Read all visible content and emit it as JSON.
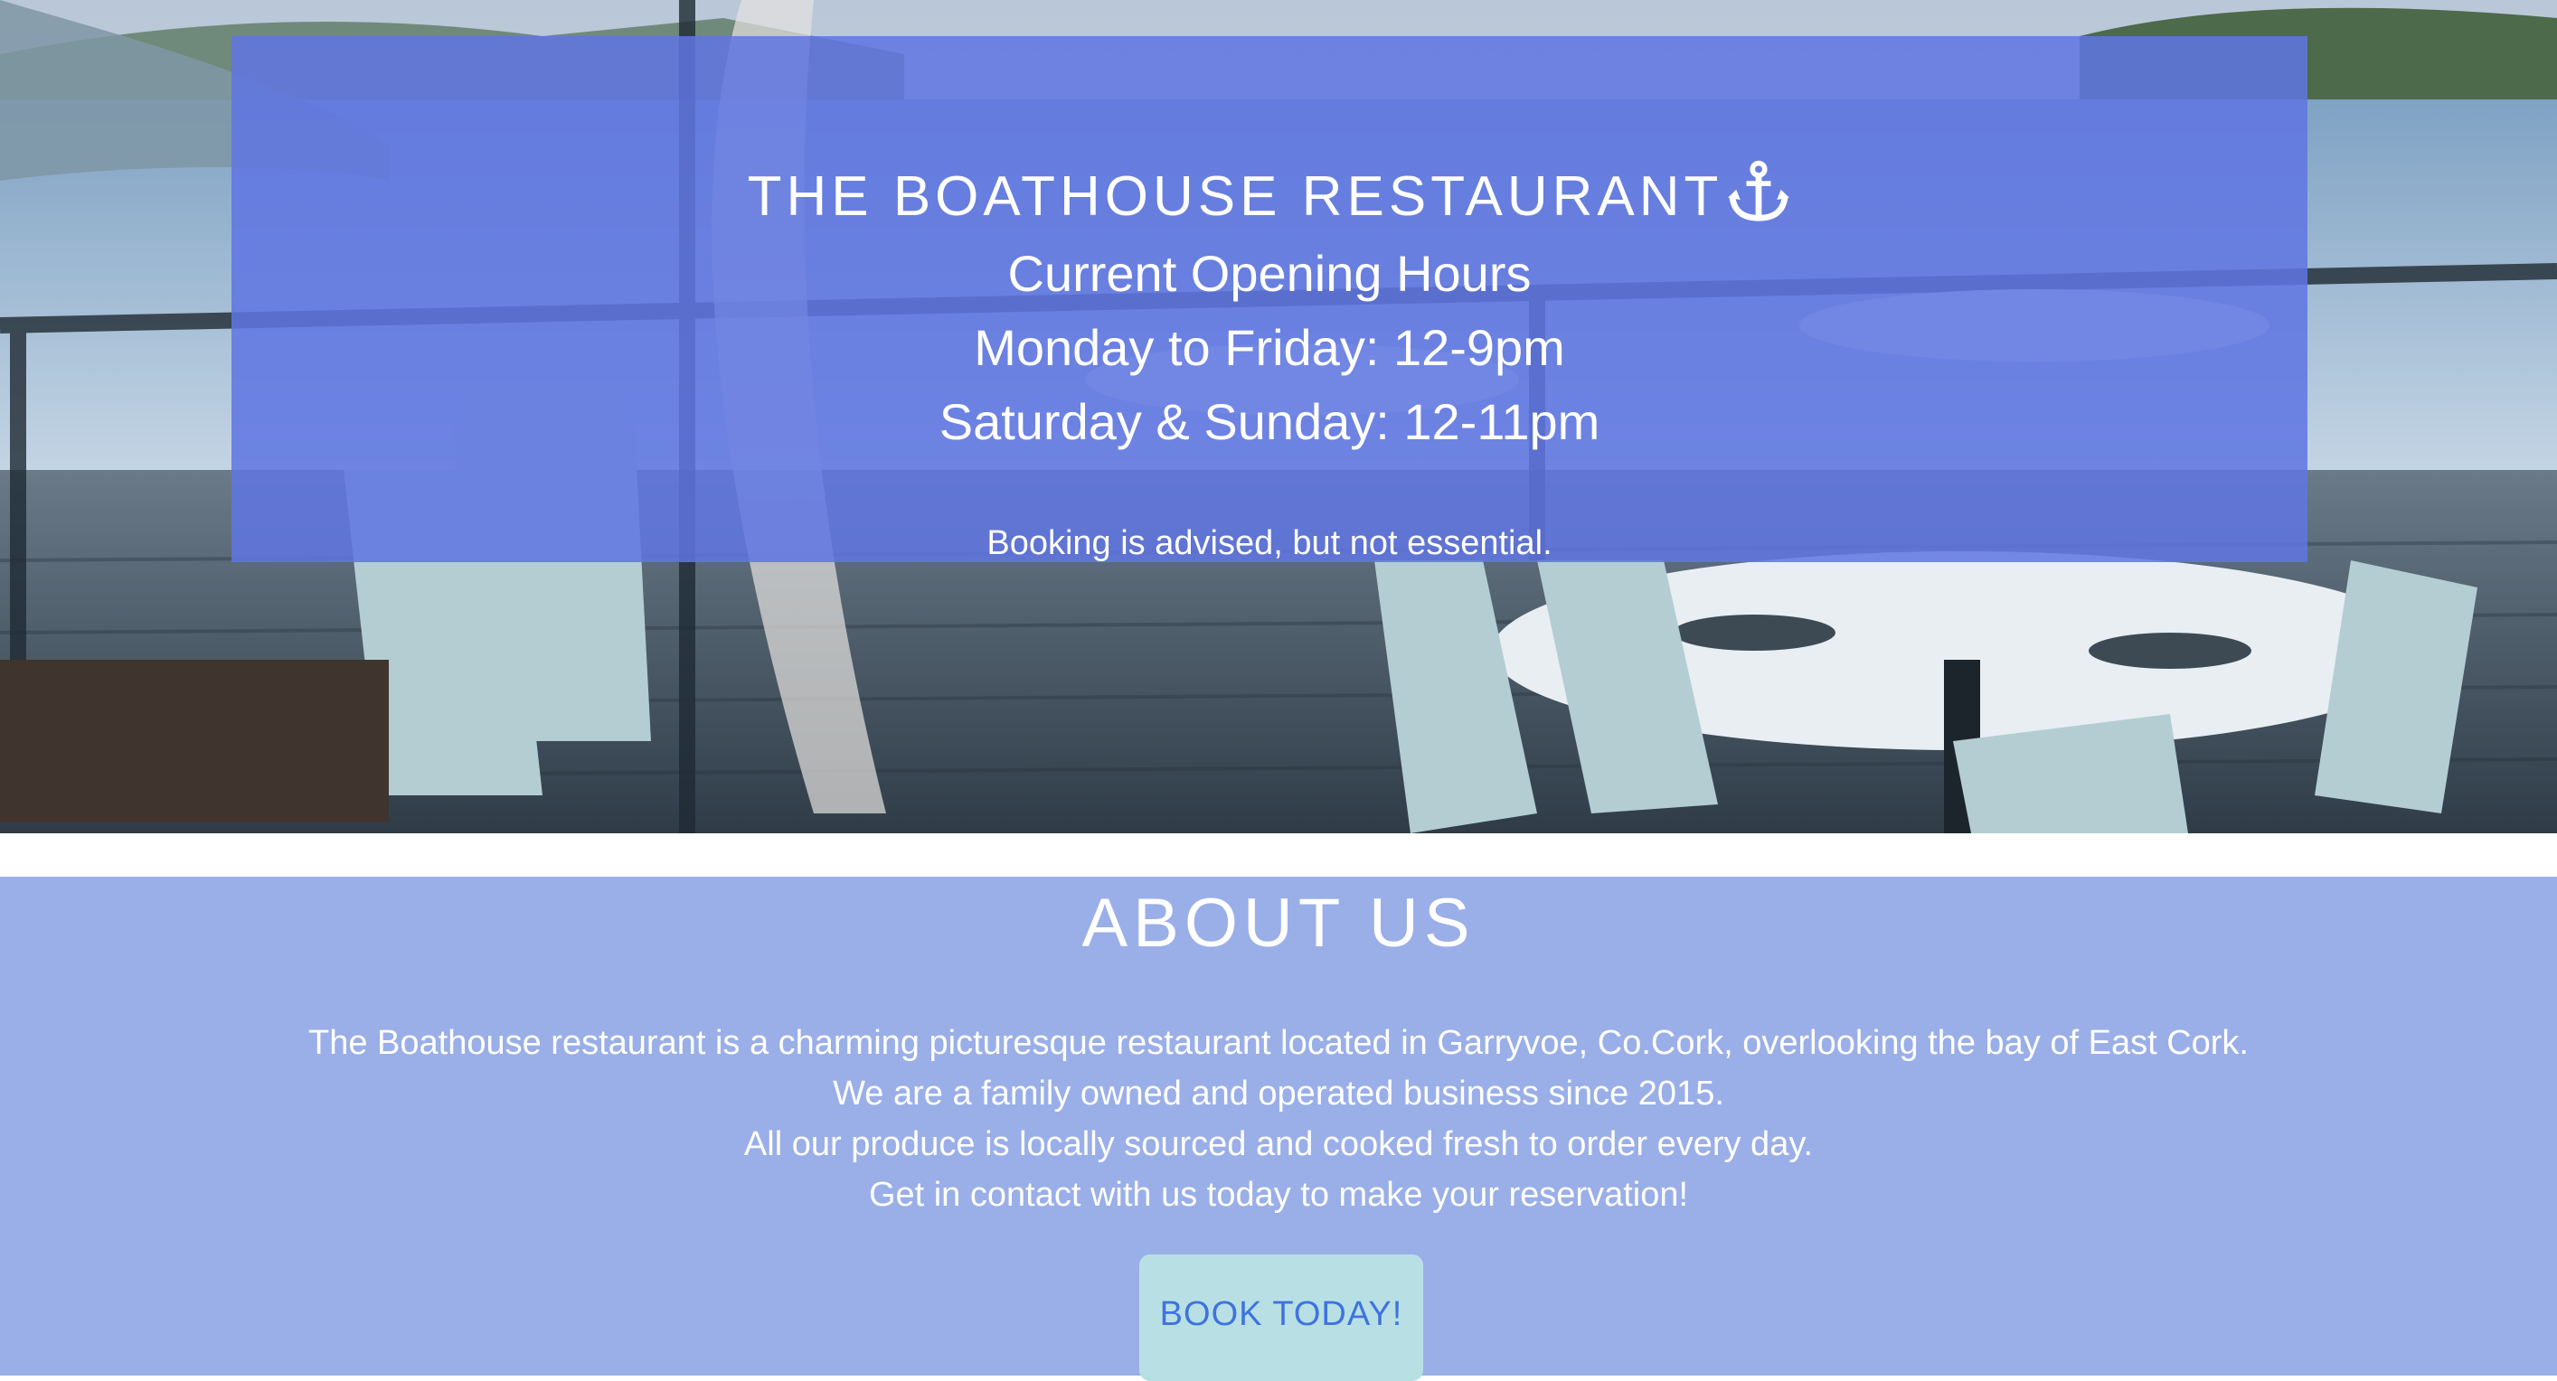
{
  "hero": {
    "title": "THE BOATHOUSE RESTAURANT",
    "title_icon": "anchor-icon",
    "hours_heading": "Current Opening Hours",
    "hours_weekday": "Monday to Friday: 12-9pm",
    "hours_weekend": "Saturday & Sunday: 12-11pm",
    "booking_note": "Booking is advised, but not essential."
  },
  "about": {
    "heading": "ABOUT US",
    "paragraphs": [
      "The Boathouse restaurant is a charming picturesque restaurant located in Garryvoe, Co.Cork, overlooking the bay of East Cork.",
      "We are a family owned and operated business since 2015.",
      "All our produce is locally sourced and cooked fresh to order every day.",
      "Get in contact with us today to make your reservation!"
    ],
    "book_button": "BOOK TODAY!"
  },
  "colors": {
    "hero_overlay": "#5f76e2",
    "about_background": "#9aafe8",
    "button_background": "#b8e0e4",
    "button_text": "#3e73e0"
  }
}
